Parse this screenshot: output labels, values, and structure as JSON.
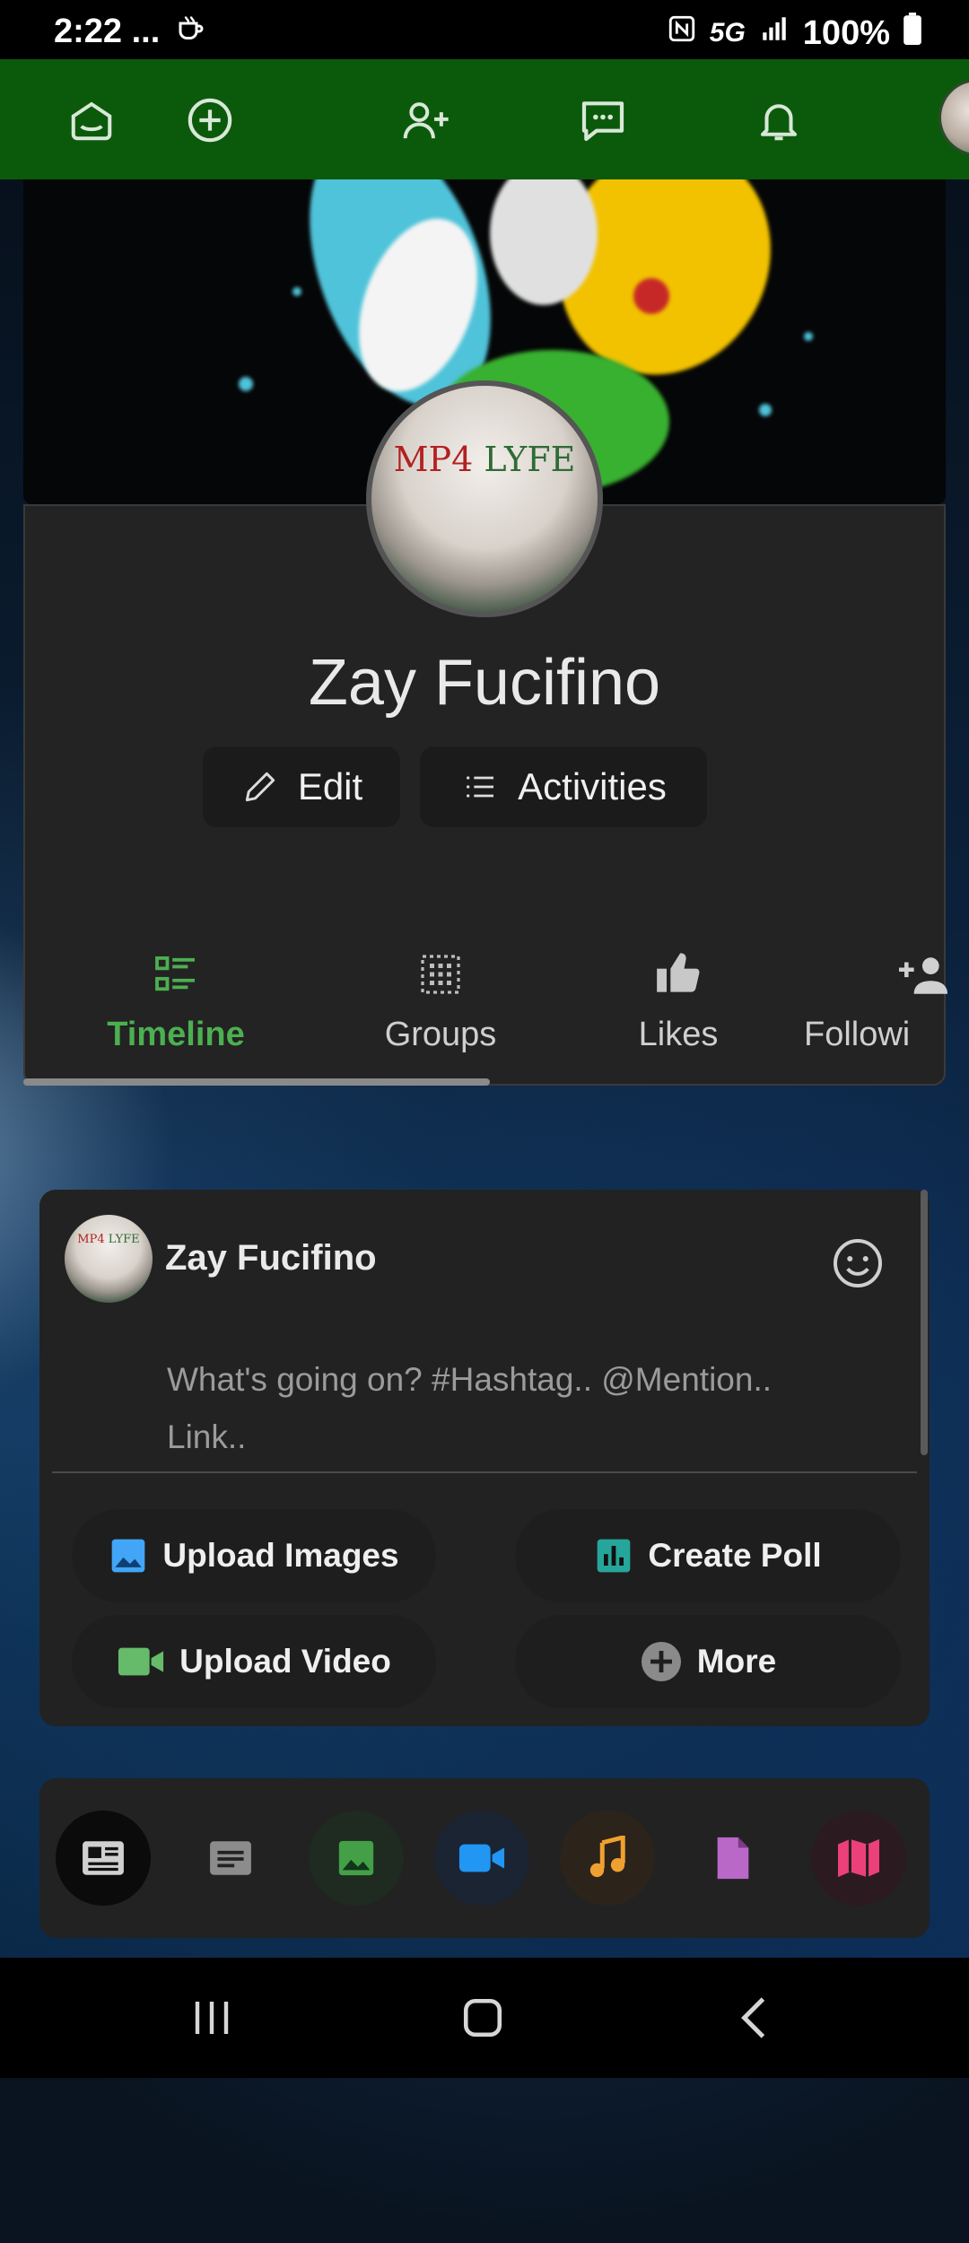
{
  "status_bar": {
    "time": "2:22",
    "extra": "...",
    "network": "5G",
    "battery": "100%"
  },
  "top_nav": {
    "items": [
      "home",
      "create",
      "add-friend",
      "messages",
      "notifications"
    ]
  },
  "profile": {
    "name": "Zay Fucifino",
    "avatar_text_red": "MP4",
    "avatar_text_green": "LYFE",
    "edit_label": "Edit",
    "activities_label": "Activities"
  },
  "tabs": [
    {
      "label": "Timeline",
      "icon": "timeline-icon",
      "active": true
    },
    {
      "label": "Groups",
      "icon": "groups-icon",
      "active": false
    },
    {
      "label": "Likes",
      "icon": "thumbs-up-icon",
      "active": false
    },
    {
      "label": "Followi",
      "icon": "add-person-icon",
      "active": false
    }
  ],
  "composer": {
    "user_name": "Zay Fucifino",
    "placeholder": "What's going on? #Hashtag.. @Mention.. Link..",
    "actions": {
      "upload_images": "Upload Images",
      "create_poll": "Create Poll",
      "upload_video": "Upload Video",
      "more": "More"
    }
  },
  "media_bar": {
    "items": [
      "all-posts",
      "text",
      "photos",
      "videos",
      "music",
      "files",
      "maps"
    ]
  },
  "colors": {
    "nav_green": "#0b5a0b",
    "active_tab": "#4caf50",
    "card_bg": "#232323",
    "images_blue": "#42a5f5",
    "poll_teal": "#26a69a",
    "video_green": "#66bb6a",
    "music_orange": "#f0a030",
    "file_purple": "#ba68c8",
    "map_pink": "#ec407a"
  }
}
